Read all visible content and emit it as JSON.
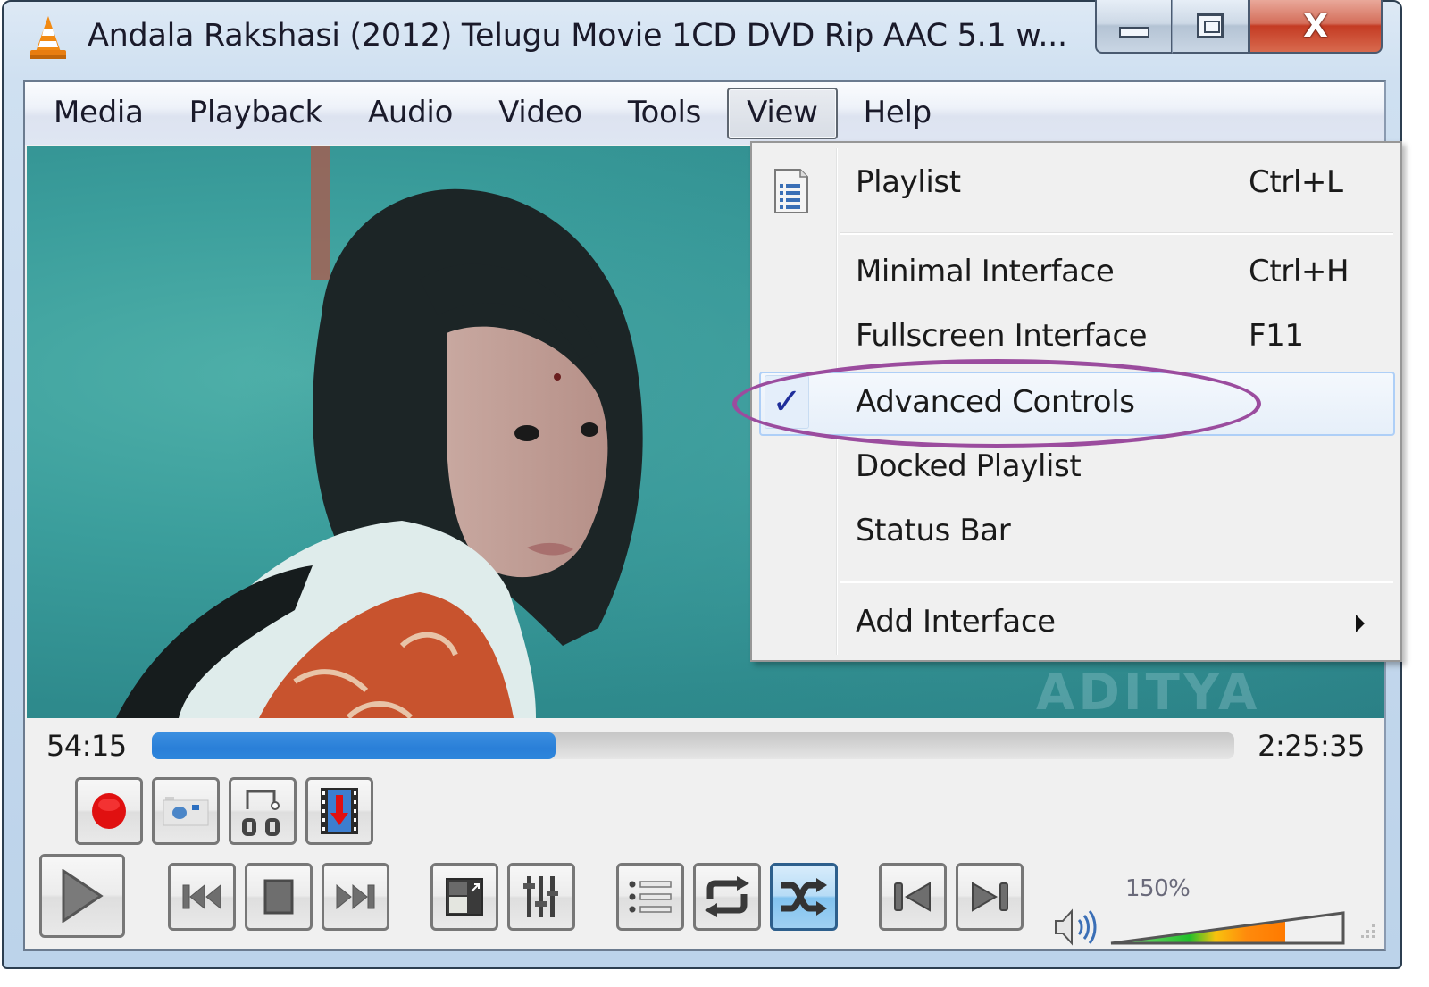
{
  "window": {
    "title": "Andala Rakshasi (2012) Telugu Movie 1CD DVD Rip AAC 5.1 w...",
    "app_icon": "vlc-cone-icon",
    "caption_buttons": [
      {
        "name": "minimize",
        "icon": "minimize-icon"
      },
      {
        "name": "maximize",
        "icon": "maximize-icon"
      },
      {
        "name": "close",
        "icon": "close-icon",
        "glyph": "X"
      }
    ]
  },
  "menubar": {
    "items": [
      {
        "label": "Media"
      },
      {
        "label": "Playback"
      },
      {
        "label": "Audio"
      },
      {
        "label": "Video"
      },
      {
        "label": "Tools"
      },
      {
        "label": "View",
        "open": true
      },
      {
        "label": "Help"
      }
    ]
  },
  "view_menu": {
    "items": [
      {
        "label": "Playlist",
        "shortcut": "Ctrl+L",
        "icon": "playlist-document-icon"
      },
      {
        "label": "Minimal Interface",
        "shortcut": "Ctrl+H"
      },
      {
        "label": "Fullscreen Interface",
        "shortcut": "F11"
      },
      {
        "label": "Advanced Controls",
        "shortcut": "",
        "checked": true,
        "highlighted": true,
        "check_glyph": "✓"
      },
      {
        "label": "Docked Playlist",
        "shortcut": ""
      },
      {
        "label": "Status Bar",
        "shortcut": ""
      },
      {
        "label": "Add Interface",
        "shortcut": "",
        "submenu": true
      }
    ]
  },
  "video": {
    "watermark": "ADITYA"
  },
  "playback": {
    "elapsed": "54:15",
    "total": "2:25:35",
    "progress_fraction": 0.373
  },
  "advanced_controls": [
    {
      "name": "record",
      "icon": "record-icon"
    },
    {
      "name": "snapshot",
      "icon": "camera-icon"
    },
    {
      "name": "loop-a-b",
      "icon": "ab-loop-icon"
    },
    {
      "name": "frame-by-frame",
      "icon": "film-frame-icon"
    }
  ],
  "main_controls": [
    {
      "name": "play",
      "icon": "play-icon"
    },
    {
      "name": "previous",
      "icon": "previous-icon"
    },
    {
      "name": "stop",
      "icon": "stop-icon"
    },
    {
      "name": "next",
      "icon": "next-icon"
    },
    {
      "name": "fullscreen",
      "icon": "fullscreen-icon"
    },
    {
      "name": "extended-settings",
      "icon": "equalizer-sliders-icon"
    },
    {
      "name": "playlist",
      "icon": "playlist-icon"
    },
    {
      "name": "loop",
      "icon": "loop-icon"
    },
    {
      "name": "random",
      "icon": "shuffle-icon",
      "active": true
    },
    {
      "name": "frame-back",
      "icon": "step-back-icon"
    },
    {
      "name": "frame-forward",
      "icon": "step-forward-icon"
    }
  ],
  "volume": {
    "label": "150%",
    "level_fraction": 0.75,
    "icon": "speaker-icon"
  },
  "colors": {
    "progress": "#2a7fd8",
    "active_toggle": "#82c3ef",
    "annotation": "#9b4c9e",
    "checkmark": "#1f2e9a"
  }
}
